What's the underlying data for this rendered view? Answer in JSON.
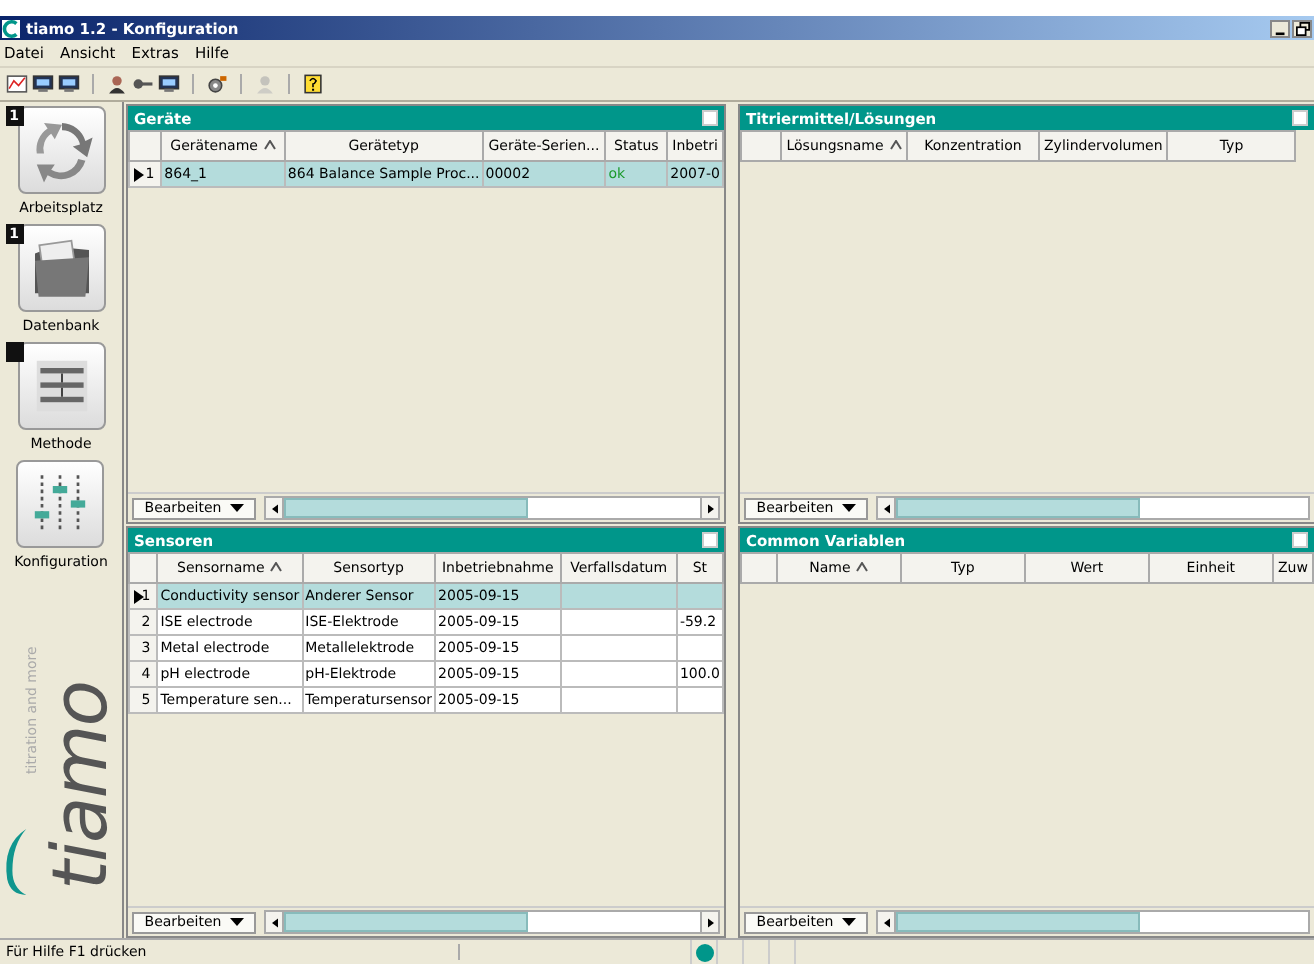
{
  "window": {
    "title": "tiamo 1.2 - Konfiguration"
  },
  "menu": [
    "Datei",
    "Ansicht",
    "Extras",
    "Hilfe"
  ],
  "toolbar": [
    {
      "kind": "report",
      "disabled": false
    },
    {
      "kind": "monitor",
      "disabled": false
    },
    {
      "kind": "monitor",
      "disabled": false
    },
    {
      "kind": "sep"
    },
    {
      "kind": "user",
      "disabled": false
    },
    {
      "kind": "key",
      "disabled": false
    },
    {
      "kind": "monitor",
      "disabled": false
    },
    {
      "kind": "sep"
    },
    {
      "kind": "gear",
      "disabled": false
    },
    {
      "kind": "sep"
    },
    {
      "kind": "user",
      "disabled": true
    },
    {
      "kind": "sep"
    },
    {
      "kind": "help",
      "disabled": false
    }
  ],
  "sidebar": {
    "items": [
      {
        "label": "Arbeitsplatz",
        "kind": "cycle",
        "badge": "1",
        "marked": true
      },
      {
        "label": "Datenbank",
        "kind": "folder",
        "badge": "1",
        "marked": true
      },
      {
        "label": "Methode",
        "kind": "method",
        "marked": true
      },
      {
        "label": "Konfiguration",
        "kind": "sliders",
        "marked": false
      }
    ],
    "logo": {
      "name": "tiamo",
      "tagline": "titration and more"
    }
  },
  "panels": [
    {
      "title": "Geräte",
      "columns": [
        {
          "label": "Gerätename",
          "sorted": true
        },
        {
          "label": "Gerätetyp",
          "sorted": false
        },
        {
          "label": "Geräte-Serien...",
          "sorted": false
        },
        {
          "label": "Status",
          "sorted": false,
          "kind": "status"
        },
        {
          "label": "Inbetri",
          "sorted": false
        }
      ],
      "rows": [
        {
          "number": "1",
          "selected": true,
          "cells": [
            "864_1",
            "864 Balance Sample Proc...",
            "00002",
            "ok",
            "2007-0"
          ]
        }
      ],
      "button": "Bearbeiten"
    },
    {
      "title": "Titriermittel/Lösungen",
      "columns": [
        {
          "label": "Lösungsname",
          "sorted": true
        },
        {
          "label": "Konzentration",
          "sorted": false
        },
        {
          "label": "Zylindervolumen",
          "sorted": false
        },
        {
          "label": "Typ",
          "sorted": false
        }
      ],
      "button": "Bearbeiten"
    },
    {
      "title": "Sensoren",
      "columns": [
        {
          "label": "Sensorname",
          "sorted": true
        },
        {
          "label": "Sensortyp",
          "sorted": false
        },
        {
          "label": "Inbetriebnahme",
          "sorted": false
        },
        {
          "label": "Verfallsdatum",
          "sorted": false
        },
        {
          "label": "St",
          "sorted": false
        }
      ],
      "rows": [
        {
          "number": "1",
          "selected": true,
          "cells": [
            "Conductivity sensor",
            "Anderer Sensor",
            "2005-09-15",
            "",
            ""
          ]
        },
        {
          "number": "2",
          "selected": false,
          "cells": [
            "ISE electrode",
            "ISE-Elektrode",
            "2005-09-15",
            "",
            "-59.2"
          ]
        },
        {
          "number": "3",
          "selected": false,
          "cells": [
            "Metal electrode",
            "Metallelektrode",
            "2005-09-15",
            "",
            ""
          ]
        },
        {
          "number": "4",
          "selected": false,
          "cells": [
            "pH electrode",
            "pH-Elektrode",
            "2005-09-15",
            "",
            "100.0"
          ]
        },
        {
          "number": "5",
          "selected": false,
          "cells": [
            "Temperature sen...",
            "Temperatursensor",
            "2005-09-15",
            "",
            ""
          ]
        }
      ],
      "button": "Bearbeiten"
    },
    {
      "title": "Common Variablen",
      "columns": [
        {
          "label": "Name",
          "sorted": true
        },
        {
          "label": "Typ",
          "sorted": false
        },
        {
          "label": "Wert",
          "sorted": false
        },
        {
          "label": "Einheit",
          "sorted": false
        },
        {
          "label": "Zuw",
          "sorted": false
        }
      ],
      "button": "Bearbeiten"
    }
  ],
  "status_bar": {
    "text": "Für Hilfe F1 drücken",
    "connected": true
  }
}
